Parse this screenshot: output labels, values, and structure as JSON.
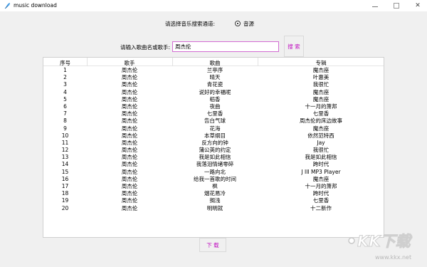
{
  "window": {
    "title": "music download",
    "minimize_icon": "minimize-icon",
    "maximize_icon": "maximize-icon",
    "close_icon": "close-icon",
    "close_glyph": "✕"
  },
  "source": {
    "label": "请选择音乐搜索通道:",
    "options": [
      {
        "label": "音源",
        "selected": true
      }
    ]
  },
  "search": {
    "label": "请输入歌曲名或歌手:",
    "value": "周杰伦",
    "button_label": "搜 索"
  },
  "table": {
    "columns": [
      "序号",
      "歌手",
      "歌曲",
      "专辑"
    ],
    "rows": [
      [
        "1",
        "周杰伦",
        "兰亭序",
        "魔杰座"
      ],
      [
        "2",
        "周杰伦",
        "晴天",
        "叶惠美"
      ],
      [
        "3",
        "周杰伦",
        "青花瓷",
        "我很忙"
      ],
      [
        "4",
        "周杰伦",
        "说好的幸福呢",
        "魔杰座"
      ],
      [
        "5",
        "周杰伦",
        "稻香",
        "魔杰座"
      ],
      [
        "6",
        "周杰伦",
        "夜曲",
        "十一月的萧邦"
      ],
      [
        "7",
        "周杰伦",
        "七里香",
        "七里香"
      ],
      [
        "8",
        "周杰伦",
        "告白气球",
        "周杰伦的床边故事"
      ],
      [
        "9",
        "周杰伦",
        "花海",
        "魔杰座"
      ],
      [
        "10",
        "周杰伦",
        "本草纲目",
        "依然范特西"
      ],
      [
        "11",
        "周杰伦",
        "反方向的钟",
        "Jay"
      ],
      [
        "12",
        "周杰伦",
        "蒲公英的约定",
        "我很忙"
      ],
      [
        "13",
        "周杰伦",
        "我是如此相信",
        "我是如此相信"
      ],
      [
        "14",
        "周杰伦",
        "我落泪情绪零碎",
        "跨时代"
      ],
      [
        "15",
        "周杰伦",
        "一路向北",
        "J III MP3 Player"
      ],
      [
        "16",
        "周杰伦",
        "给我一首歌的时间",
        "魔杰座"
      ],
      [
        "17",
        "周杰伦",
        "枫",
        "十一月的萧邦"
      ],
      [
        "18",
        "周杰伦",
        "烟花易冷",
        "跨时代"
      ],
      [
        "19",
        "周杰伦",
        "搁浅",
        "七里香"
      ],
      [
        "20",
        "周杰伦",
        "明明就",
        "十二新作"
      ]
    ]
  },
  "download": {
    "button_label": "下 载"
  },
  "watermark": {
    "text": "KK下载",
    "url": "www.kkx.net"
  },
  "colors": {
    "accent": "#c010c0",
    "input_border": "#d26cd2",
    "window_bg": "#f0f0f0"
  }
}
